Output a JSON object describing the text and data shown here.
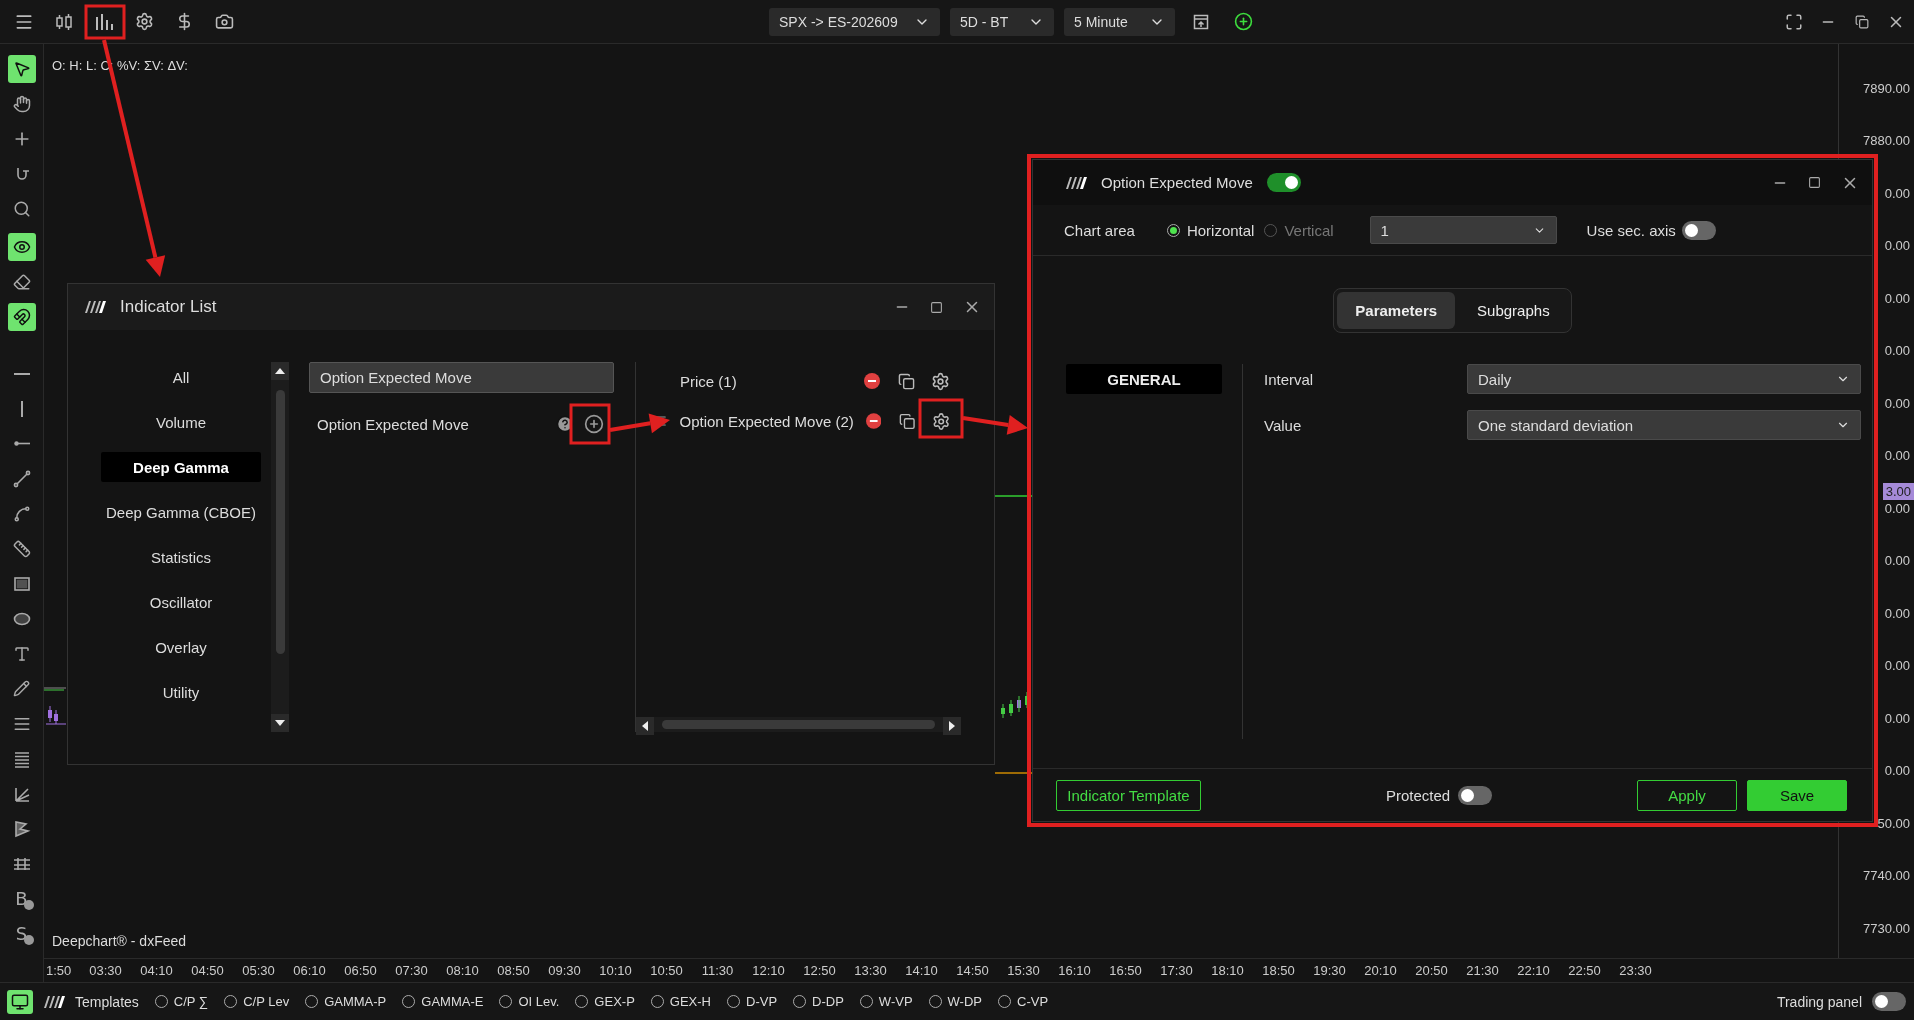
{
  "top_bar": {
    "dropdowns": [
      {
        "value": "SPX -> ES-202609"
      },
      {
        "value": "5D - BT"
      },
      {
        "value": "5 Minute"
      }
    ]
  },
  "toolbar": {
    "groups": [
      {
        "tools": [
          {
            "kind": "pointer",
            "active": true
          },
          {
            "kind": "hand",
            "active": false
          },
          {
            "kind": "crosshair",
            "active": false
          },
          {
            "kind": "snap",
            "active": false
          },
          {
            "kind": "zoom",
            "active": false
          }
        ]
      },
      {
        "tools": [
          {
            "kind": "eye",
            "active": true
          },
          {
            "kind": "eraser",
            "active": false
          },
          {
            "kind": "magnet",
            "active": true
          }
        ]
      },
      {
        "tools": [
          {
            "kind": "hline",
            "active": false
          },
          {
            "kind": "vline",
            "active": false
          },
          {
            "kind": "ray",
            "active": false
          },
          {
            "kind": "line",
            "active": false
          },
          {
            "kind": "polyline",
            "active": false
          },
          {
            "kind": "ruler",
            "active": false
          },
          {
            "kind": "rectangle",
            "active": false
          },
          {
            "kind": "ellipse",
            "active": false
          },
          {
            "kind": "text",
            "active": false
          },
          {
            "kind": "pencil",
            "active": false
          },
          {
            "kind": "lines",
            "active": false
          },
          {
            "kind": "lines-dense",
            "active": false
          },
          {
            "kind": "fib",
            "active": false
          },
          {
            "kind": "pattern",
            "active": false
          },
          {
            "kind": "levels",
            "active": false
          },
          {
            "kind": "letter-coin",
            "letter": "B",
            "active": false
          },
          {
            "kind": "letter-coin",
            "letter": "S",
            "active": false
          }
        ]
      }
    ]
  },
  "chart": {
    "ohlc_legend": "O: H: L: C: %V: ΣV: ΔV:",
    "feed_label": "Deepchart® - dxFeed",
    "price_tag": "3.00"
  },
  "price_axis": {
    "labels": [
      "7890.00",
      "7880.00",
      "0.00",
      "0.00",
      "0.00",
      "0.00",
      "0.00",
      "0.00",
      "0.00",
      "0.00",
      "0.00",
      "0.00",
      "0.00",
      "0.00",
      "50.00",
      "7740.00",
      "7730.00"
    ]
  },
  "time_axis": {
    "labels": [
      "1:50",
      "03:30",
      "04:10",
      "04:50",
      "05:30",
      "06:10",
      "06:50",
      "07:30",
      "08:10",
      "08:50",
      "09:30",
      "10:10",
      "10:50",
      "11:30",
      "12:10",
      "12:50",
      "13:30",
      "14:10",
      "14:50",
      "15:30",
      "16:10",
      "16:50",
      "17:30",
      "18:10",
      "18:50",
      "19:30",
      "20:10",
      "20:50",
      "21:30",
      "22:10",
      "22:50",
      "23:30"
    ]
  },
  "indicator_list": {
    "title": "Indicator List",
    "categories": [
      {
        "label": "All",
        "selected": false
      },
      {
        "label": "Volume",
        "selected": false
      },
      {
        "label": "Deep Gamma",
        "selected": true
      },
      {
        "label": "Deep Gamma (CBOE)",
        "selected": false
      },
      {
        "label": "Statistics",
        "selected": false
      },
      {
        "label": "Oscillator",
        "selected": false
      },
      {
        "label": "Overlay",
        "selected": false
      },
      {
        "label": "Utility",
        "selected": false
      }
    ],
    "search": {
      "value": "Option Expected Move"
    },
    "results": [
      {
        "label": "Option Expected Move"
      }
    ],
    "active_indicators": [
      {
        "label": "Price (1)",
        "draggable": false
      },
      {
        "label": "Option Expected Move (2)",
        "draggable": true
      }
    ]
  },
  "settings_dialog": {
    "title": "Option Expected Move",
    "enabled": true,
    "chart_area": {
      "label": "Chart area",
      "options": [
        {
          "label": "Horizontal",
          "selected": true,
          "disabled": false
        },
        {
          "label": "Vertical",
          "selected": false,
          "disabled": true
        }
      ],
      "pane": {
        "value": "1"
      },
      "secondary_axis": {
        "label": "Use sec. axis",
        "on": false
      }
    },
    "tabs": [
      {
        "label": "Parameters",
        "selected": true
      },
      {
        "label": "Subgraphs",
        "selected": false
      }
    ],
    "sections": [
      {
        "label": "GENERAL",
        "selected": true
      }
    ],
    "parameters": [
      {
        "label": "Interval",
        "value": "Daily"
      },
      {
        "label": "Value",
        "value": "One standard deviation"
      }
    ],
    "footer": {
      "template_button": "Indicator Template",
      "protected": {
        "label": "Protected",
        "on": false
      },
      "buttons": [
        {
          "label": "Apply",
          "kind": "outline"
        },
        {
          "label": "Save",
          "kind": "primary"
        }
      ]
    }
  },
  "bottom_bar": {
    "templates_label": "Templates",
    "templates": [
      {
        "label": "C/P ∑",
        "selected": false
      },
      {
        "label": "C/P Lev",
        "selected": false
      },
      {
        "label": "GAMMA-P",
        "selected": false
      },
      {
        "label": "GAMMA-E",
        "selected": false
      },
      {
        "label": "OI Lev.",
        "selected": false
      },
      {
        "label": "GEX-P",
        "selected": false
      },
      {
        "label": "GEX-H",
        "selected": false
      },
      {
        "label": "D-VP",
        "selected": false
      },
      {
        "label": "D-DP",
        "selected": false
      },
      {
        "label": "W-VP",
        "selected": false
      },
      {
        "label": "W-DP",
        "selected": false
      },
      {
        "label": "C-VP",
        "selected": false
      }
    ],
    "trading_panel": {
      "label": "Trading panel",
      "on": false
    }
  }
}
